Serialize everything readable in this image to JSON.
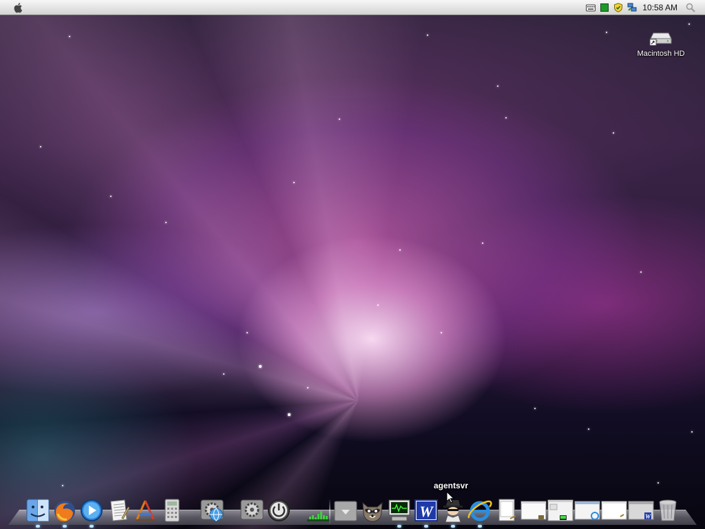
{
  "menubar": {
    "apple_menu": "apple-logo-icon",
    "tray_icons": [
      "keyboard-icon",
      "green-square-icon",
      "shield-icon",
      "network-icon"
    ],
    "clock": "10:58 AM",
    "spotlight": "magnifier-icon"
  },
  "desktop": {
    "icons": [
      {
        "label": "Macintosh HD",
        "icon": "hard-drive-icon"
      }
    ]
  },
  "dock": {
    "tooltip": "agentsvr",
    "items": [
      "finder-icon",
      "firefox-icon",
      "media-player-icon",
      "text-editor-icon",
      "app-store-icon",
      "calculator-icon",
      "settings-icon",
      "settings-update-icon",
      "power-icon",
      "activity-graph-icon",
      "downloads-stack-icon",
      "raccoon-agent-icon",
      "system-monitor-icon",
      "word-icon",
      "spy-agent-icon",
      "internet-explorer-icon",
      "document-icon",
      "window-thumbnail-icon",
      "trash-icon"
    ]
  }
}
